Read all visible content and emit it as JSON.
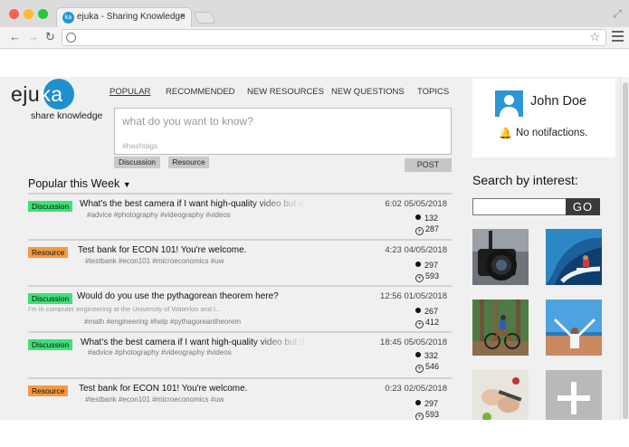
{
  "browser": {
    "tab_title": "ejuka - Sharing Knowledge",
    "tab_favicon": "ka",
    "tab_close": "×"
  },
  "logo": {
    "part1": "eju",
    "part2": "ka",
    "tagline": "share knowledge"
  },
  "topnav": [
    "POPULAR",
    "RECOMMENDED",
    "NEW RESOURCES",
    "NEW QUESTIONS",
    "TOPICS"
  ],
  "ask": {
    "placeholder": "what do you want to know?",
    "hashtags_placeholder": "#hashtags",
    "discussion_label": "Discussion",
    "resource_label": "Resource",
    "post_label": "POST"
  },
  "section_title": "Popular this Week",
  "posts": [
    {
      "type": "Discussion",
      "title": "What's the best camera if I want high-quality video but d",
      "sub": "",
      "tags": "#advice   #photography   #videography   #videos",
      "time": "6:02  05/05/2018",
      "comments": "132",
      "votes": "287"
    },
    {
      "type": "Resource",
      "title": "Test bank for ECON 101! You're welcome.",
      "sub": "",
      "tags": "#testbank   #econ101   #microeconomics   #uw",
      "time": "4:23  04/05/2018",
      "comments": "297",
      "votes": "593"
    },
    {
      "type": "Discussion",
      "title": "Would do you use the pythagorean theorem here?",
      "sub": "I'm in computer engineering at the University of Waterloo and I...",
      "tags": "#math   #engineering   #help   #pythagoreantheorem",
      "time": "12:56  01/05/2018",
      "comments": "267",
      "votes": "412"
    },
    {
      "type": "Discussion",
      "title": "What's the best camera if I want high-quality video but d",
      "sub": "",
      "tags": "#advice   #photography   #videography   #videos",
      "time": "18:45  05/05/2018",
      "comments": "332",
      "votes": "546"
    },
    {
      "type": "Resource",
      "title": "Test bank for ECON 101! You're welcome.",
      "sub": "",
      "tags": "#testbank   #econ101   #microeconomics   #uw",
      "time": "0:23  02/05/2018",
      "comments": "297",
      "votes": "593"
    }
  ],
  "profile": {
    "name": "John Doe",
    "notifications": "No notifactions."
  },
  "interest": {
    "title": "Search by interest:",
    "go_label": "GO",
    "add_symbol": "+"
  },
  "colors": {
    "brand": "#1f8fcf",
    "discussion": "#3ee078",
    "resource": "#f59b3d"
  }
}
